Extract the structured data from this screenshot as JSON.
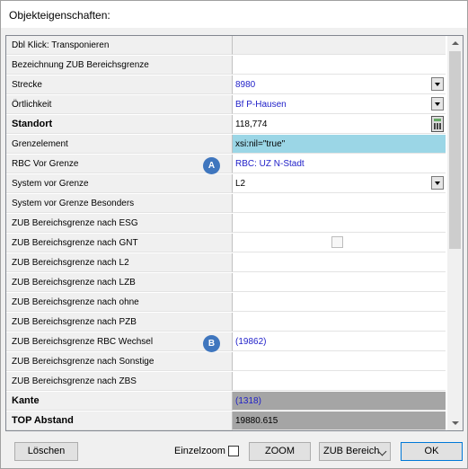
{
  "window": {
    "title": "Objekteigenschaften:"
  },
  "grid": {
    "rows": [
      {
        "label": "Dbl Klick: Transponieren",
        "value": ""
      },
      {
        "label": "Bezeichnung ZUB Bereichsgrenze",
        "value": ""
      },
      {
        "label": "Strecke",
        "value": "8980"
      },
      {
        "label": "Örtlichkeit",
        "value": "Bf P-Hausen"
      },
      {
        "label": "Standort",
        "value": "118,774"
      },
      {
        "label": "Grenzelement",
        "value": "xsi:nil=\"true\""
      },
      {
        "label": "RBC Vor Grenze",
        "value": "RBC: UZ N-Stadt"
      },
      {
        "label": "System vor Grenze",
        "value": "L2"
      },
      {
        "label": "System vor Grenze Besonders",
        "value": ""
      },
      {
        "label": "ZUB Bereichsgrenze nach ESG",
        "value": ""
      },
      {
        "label": "ZUB Bereichsgrenze nach GNT",
        "value": ""
      },
      {
        "label": "ZUB Bereichsgrenze nach L2",
        "value": ""
      },
      {
        "label": "ZUB Bereichsgrenze nach LZB",
        "value": ""
      },
      {
        "label": "ZUB Bereichsgrenze nach ohne",
        "value": ""
      },
      {
        "label": "ZUB Bereichsgrenze nach PZB",
        "value": ""
      },
      {
        "label": "ZUB Bereichsgrenze RBC Wechsel",
        "value": "(19862)"
      },
      {
        "label": "ZUB Bereichsgrenze nach Sonstige",
        "value": ""
      },
      {
        "label": "ZUB Bereichsgrenze nach ZBS",
        "value": ""
      },
      {
        "label": "Kante",
        "value": "(1318)"
      },
      {
        "label": "TOP Abstand",
        "value": "19880.615"
      }
    ]
  },
  "badges": {
    "a": "A",
    "b": "B"
  },
  "footer": {
    "delete_label": "Löschen",
    "zoom_checkbox_label": "Einzelzoom",
    "zoom_label": "ZOOM",
    "combo_value": "ZUB Bereich",
    "ok_label": "OK"
  },
  "colors": {
    "highlight": "#9bd6e6",
    "gray_row": "#a5a5a5",
    "link_blue": "#1e1ec8",
    "badge": "#3f76be"
  }
}
